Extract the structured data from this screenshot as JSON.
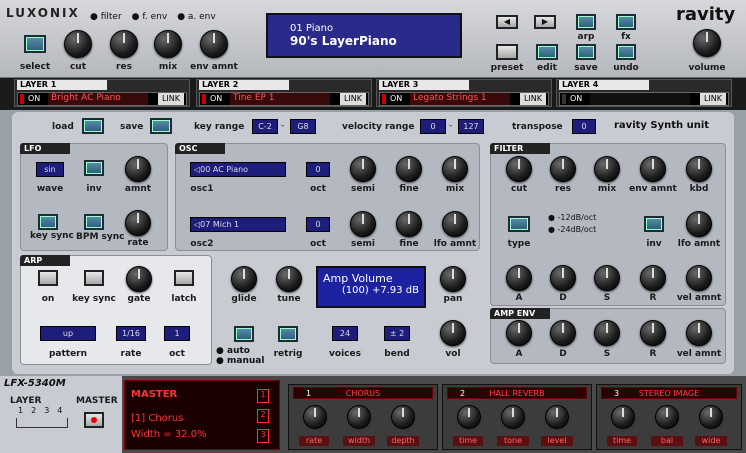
{
  "header": {
    "brand": "LUXONIX",
    "product": "ravity",
    "modes": [
      "filter",
      "f. env",
      "a. env"
    ],
    "knobs": [
      "select",
      "cut",
      "res",
      "mix",
      "env amnt"
    ],
    "display": {
      "line1": "01 Piano",
      "line2": "90's LayerPiano"
    },
    "buttons": [
      "preset",
      "edit",
      "save",
      "undo"
    ],
    "arp_label": "arp",
    "fx_label": "fx",
    "volume_label": "volume"
  },
  "layers": [
    {
      "title": "LAYER 1",
      "on": "ON",
      "name": "Bright AC Piano",
      "link": "LINK"
    },
    {
      "title": "LAYER 2",
      "on": "ON",
      "name": "Tine EP 1",
      "link": "LINK"
    },
    {
      "title": "LAYER 3",
      "on": "ON",
      "name": "Legato Strings 1",
      "link": "LINK"
    },
    {
      "title": "LAYER 4",
      "on": "ON",
      "name": "",
      "link": "LINK"
    }
  ],
  "toolbar": {
    "load": "load",
    "save": "save",
    "key_range_label": "key range",
    "key_lo": "C-2",
    "key_hi": "G8",
    "vel_label": "velocity range",
    "vel_lo": "0",
    "vel_hi": "127",
    "transpose_label": "transpose",
    "transpose": "0",
    "unit": "ravity  Synth unit"
  },
  "lfo": {
    "title": "LFO",
    "wave": "sin",
    "labels": [
      "wave",
      "inv",
      "amnt",
      "key sync",
      "BPM sync",
      "rate"
    ]
  },
  "osc": {
    "title": "OSC",
    "osc1": "◁00 AC Piano",
    "osc2": "◁07 Mich 1",
    "oct1": "0",
    "oct2": "0",
    "labels": [
      "osc1",
      "oct",
      "semi",
      "fine",
      "mix",
      "osc2",
      "oct",
      "semi",
      "fine",
      "lfo amnt"
    ]
  },
  "filter": {
    "title": "FILTER",
    "labels": [
      "cut",
      "res",
      "mix",
      "env amnt",
      "kbd",
      "type",
      "inv",
      "lfo amnt",
      "A",
      "D",
      "S",
      "R",
      "vel amnt"
    ],
    "slope1": "-12dB/oct",
    "slope2": "-24dB/oct"
  },
  "arp": {
    "title": "ARP",
    "labels": [
      "on",
      "key sync",
      "gate",
      "latch",
      "pattern",
      "rate",
      "oct"
    ],
    "pattern": "up",
    "rate": "1/16",
    "oct": "1"
  },
  "mid": {
    "glide": "glide",
    "tune": "tune",
    "pan": "pan",
    "vol": "vol",
    "retrig": "retrig",
    "voices_label": "voices",
    "voices": "24",
    "bend_label": "bend",
    "bend": "± 2",
    "auto": "auto",
    "manual": "manual",
    "display1": "Amp Volume",
    "display2": "(100) +7.93 dB"
  },
  "ampenv": {
    "title": "AMP ENV",
    "labels": [
      "A",
      "D",
      "S",
      "R",
      "vel amnt"
    ]
  },
  "bottom": {
    "model": "LFX-5340M",
    "layer": "LAYER",
    "master": "MASTER",
    "nums": [
      "1",
      "2",
      "3",
      "4"
    ],
    "master_title": "MASTER",
    "master_line1": "[1] Chorus",
    "master_line2": "Width = 32.0%",
    "slots": [
      "1",
      "2",
      "3"
    ],
    "fx": [
      {
        "num": "1",
        "name": "CHORUS",
        "params": [
          "rate",
          "width",
          "depth"
        ]
      },
      {
        "num": "2",
        "name": "HALL REVERB",
        "params": [
          "time",
          "tone",
          "level"
        ]
      },
      {
        "num": "3",
        "name": "STEREO IMAGE",
        "params": [
          "time",
          "bal",
          "wide"
        ]
      }
    ]
  }
}
